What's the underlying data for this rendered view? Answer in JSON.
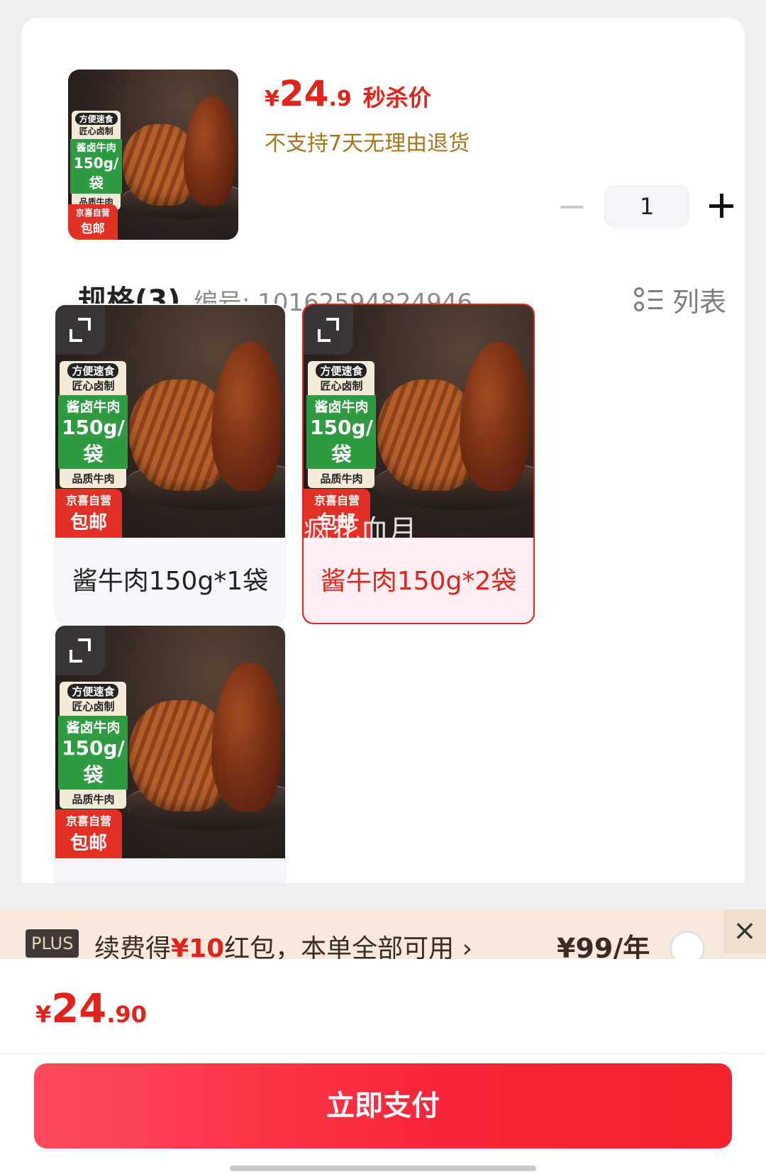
{
  "product": {
    "thumb_labels": {
      "tag": "方便速食",
      "line1": "匠心卤制",
      "green1": "酱卤牛肉",
      "green2": "150g/袋",
      "line2": "品质牛肉",
      "red1": "京喜自营",
      "red2": "包邮"
    },
    "price_yen": "¥",
    "price_int": "24",
    "price_dec": ".9",
    "price_tag": "秒杀价",
    "return_note": "不支持7天无理由退货"
  },
  "quantity": {
    "value": "1"
  },
  "spec": {
    "title": "规格(3)",
    "number": "编号: 10162594824946",
    "list_toggle": "列表",
    "options": [
      {
        "label": "酱牛肉150g*1袋",
        "selected": false
      },
      {
        "label": "酱牛肉150g*2袋",
        "selected": true
      },
      {
        "label": "",
        "selected": false
      }
    ]
  },
  "watermark": "疯花血月",
  "plus_promo": {
    "badge": "PLUS",
    "text_pre": "续费得",
    "text_highlight": "¥10",
    "text_post": "红包，本单全部可用 ›",
    "price": "¥99/年",
    "close": "×"
  },
  "footer": {
    "total_yen": "¥",
    "total_int": "24",
    "total_dec": ".90",
    "pay_label": "立即支付"
  },
  "colors": {
    "accent": "#e2231a",
    "note": "#a8741a",
    "promo_bg": "#f7eadd"
  }
}
